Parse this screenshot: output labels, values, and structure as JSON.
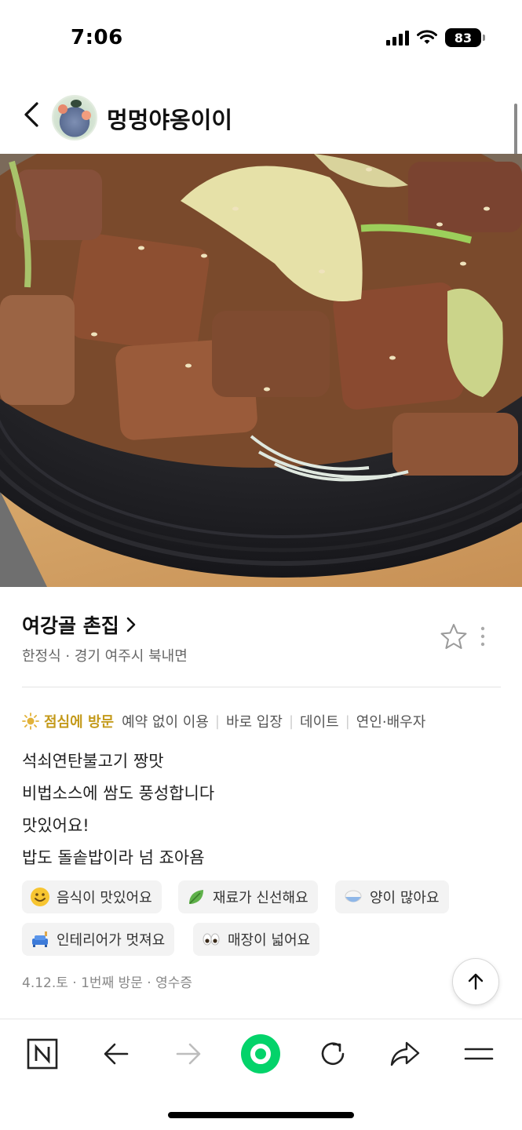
{
  "status_bar": {
    "time": "7:06",
    "battery_level": "83",
    "icons": [
      "signal-icon",
      "wifi-icon",
      "battery-icon"
    ]
  },
  "header": {
    "back_icon": "chevron-left-icon",
    "author_name": "멍멍야옹이이"
  },
  "photo": {
    "subject": "food-photo"
  },
  "place": {
    "name": "여강골 촌집",
    "chevron": "›",
    "meta": "한정식 · 경기 여주시 북내면",
    "icons": [
      "star-outline-icon",
      "more-vertical-icon"
    ]
  },
  "keywords": {
    "time_label": "점심에 방문",
    "items": [
      "예약 없이 이용",
      "바로 입장",
      "데이트",
      "연인·배우자"
    ]
  },
  "review": {
    "lines": [
      "석쇠연탄불고기 짱맛",
      "비법소스에 쌈도 풍성합니다",
      "맛있어요!",
      "밥도 돌솥밥이라 넘 죠아욤"
    ]
  },
  "tags": [
    {
      "icon": "smile-emoji-icon",
      "label": "음식이 맛있어요"
    },
    {
      "icon": "leaf-icon",
      "label": "재료가 신선해요"
    },
    {
      "icon": "rice-bowl-icon",
      "label": "양이 많아요"
    },
    {
      "icon": "sofa-icon",
      "label": "인테리어가 멋져요"
    },
    {
      "icon": "eyes-icon",
      "label": "매장이 넓어요"
    }
  ],
  "visit_info": "4.12.토 · 1번째 방문 · 영수증",
  "bottom_bar": {
    "items": [
      "naver-home-icon",
      "back-arrow-icon",
      "forward-arrow-icon",
      "green-dot-icon",
      "refresh-icon",
      "share-icon",
      "menu-icon"
    ]
  },
  "colors": {
    "accent_gold": "#c49a1b",
    "brand_green": "#03d36a",
    "chip_bg": "#f3f3f3"
  }
}
